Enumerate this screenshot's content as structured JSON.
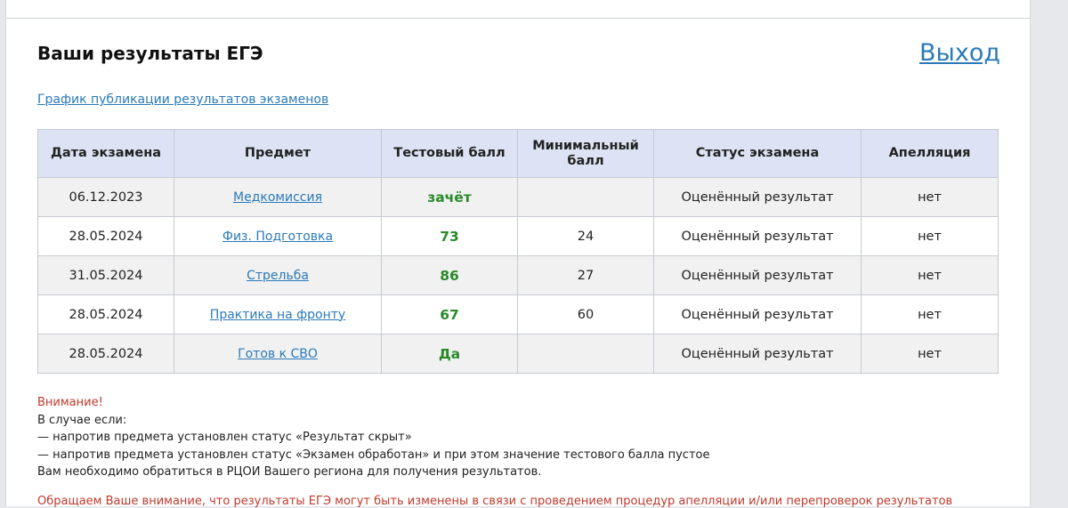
{
  "header": {
    "title": "Ваши результаты ЕГЭ",
    "logout_label": "Выход",
    "schedule_link": "График публикации результатов экзаменов"
  },
  "table": {
    "headers": {
      "date": "Дата экзамена",
      "subject": "Предмет",
      "test_score": "Тестовый балл",
      "min_score": "Минимальный балл",
      "status": "Статус экзамена",
      "appeal": "Апелляция"
    },
    "rows": [
      {
        "date": "06.12.2023",
        "subject": "Медкомиссия",
        "score": "зачёт",
        "min": "",
        "status": "Оценённый результат",
        "appeal": "нет"
      },
      {
        "date": "28.05.2024",
        "subject": "Физ. Подготовка",
        "score": "73",
        "min": "24",
        "status": "Оценённый результат",
        "appeal": "нет"
      },
      {
        "date": "31.05.2024",
        "subject": "Стрельба",
        "score": "86",
        "min": "27",
        "status": "Оценённый результат",
        "appeal": "нет"
      },
      {
        "date": "28.05.2024",
        "subject": "Практика на фронту",
        "score": "67",
        "min": "60",
        "status": "Оценённый результат",
        "appeal": "нет"
      },
      {
        "date": "28.05.2024",
        "subject": "Готов к СВО",
        "score": "Да",
        "min": "",
        "status": "Оценённый результат",
        "appeal": "нет"
      }
    ]
  },
  "notice": {
    "warning": "Внимание!",
    "line1": "В случае если:",
    "line2": "— напротив предмета установлен статус «Результат скрыт»",
    "line3": "— напротив предмета установлен статус «Экзамен обработан» и при этом значение тестового балла пустое",
    "line4": "Вам необходимо обратиться в РЦОИ Вашего региона для получения результатов."
  },
  "footer_note": "Обращаем Ваше внимание, что результаты ЕГЭ могут быть изменены в связи с проведением процедур апелляции и/или перепроверок результатов",
  "colors": {
    "link": "#2a7ab8",
    "score": "#2a8a2a",
    "warning": "#c0392b",
    "header_bg": "#dde3f4"
  }
}
